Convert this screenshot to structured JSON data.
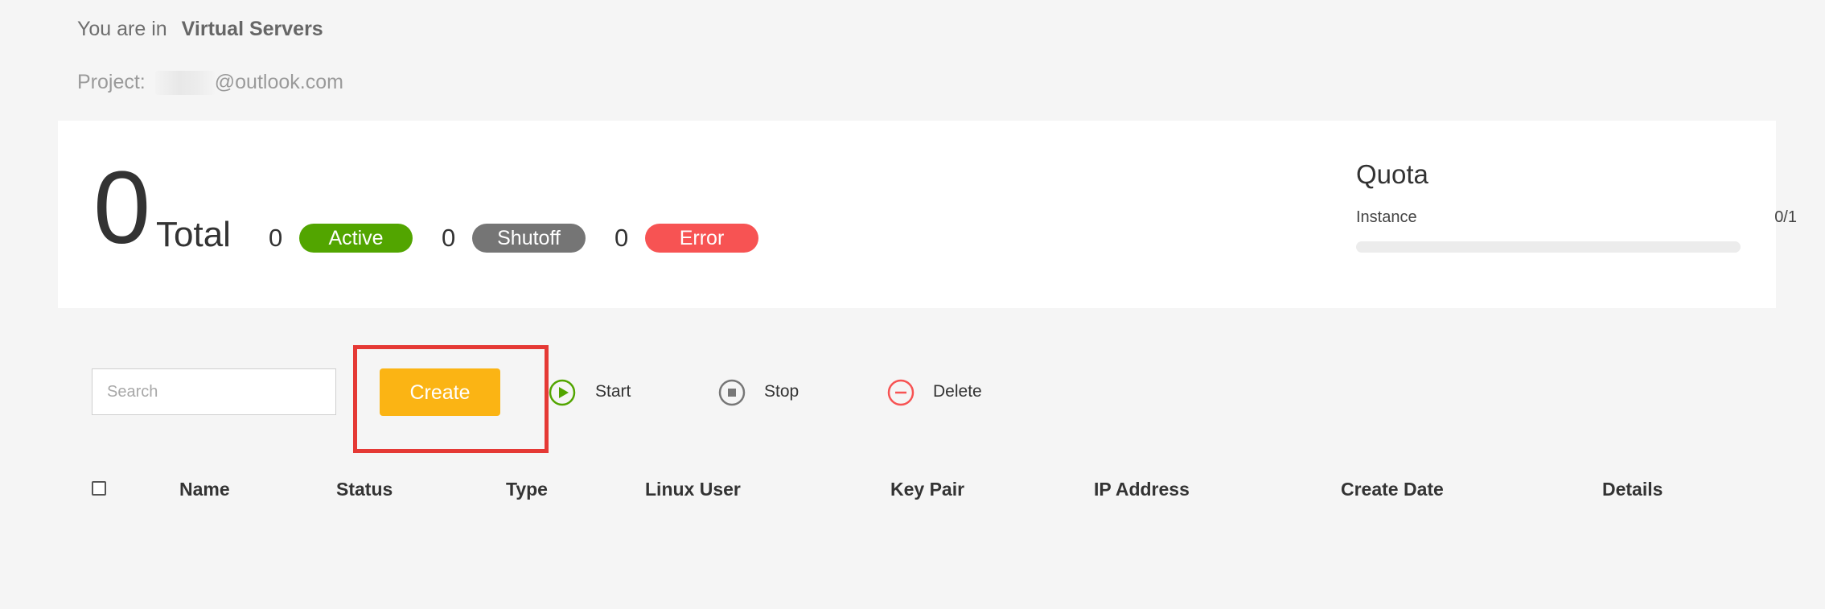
{
  "breadcrumb": {
    "prefix": "You are in",
    "current": "Virtual Servers"
  },
  "project": {
    "label": "Project:",
    "email_suffix": "@outlook.com"
  },
  "summary": {
    "total_count": "0",
    "total_label": "Total",
    "active": {
      "count": "0",
      "label": "Active",
      "color": "#52a500"
    },
    "shutoff": {
      "count": "0",
      "label": "Shutoff",
      "color": "#757575"
    },
    "error": {
      "count": "0",
      "label": "Error",
      "color": "#f75353"
    }
  },
  "quota": {
    "title": "Quota",
    "instance_label": "Instance",
    "instance_value": "0/1",
    "instance_used_fraction": 0
  },
  "toolbar": {
    "search_placeholder": "Search",
    "create_label": "Create",
    "create_color": "#fbb414",
    "start_label": "Start",
    "start_icon": "play-circle-icon",
    "stop_label": "Stop",
    "stop_icon": "stop-circle-icon",
    "delete_label": "Delete",
    "delete_icon": "minus-circle-icon"
  },
  "table": {
    "columns": [
      "Name",
      "Status",
      "Type",
      "Linux User",
      "Key Pair",
      "IP Address",
      "Create Date",
      "Details"
    ],
    "rows": []
  }
}
